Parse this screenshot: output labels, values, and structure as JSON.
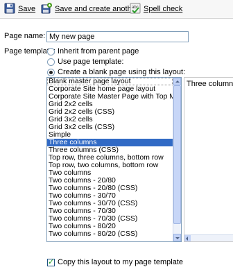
{
  "toolbar": {
    "save_label": "Save",
    "save_another_label": "Save and create another",
    "spell_label": "Spell check"
  },
  "form": {
    "page_name_label": "Page name:",
    "page_name_value": "My new page",
    "page_template_label": "Page template:",
    "radios": [
      {
        "label": "Inherit from parent page",
        "checked": false
      },
      {
        "label": "Use page template:",
        "checked": false
      },
      {
        "label": "Create a blank page using this layout:",
        "checked": true
      }
    ],
    "layouts": [
      "Blank master page layout",
      "Corporate Site home page layout",
      "Corporate Site Master Page with Top Menu",
      "Grid 2x2 cells",
      "Grid 2x2 cells (CSS)",
      "Grid 3x2 cells",
      "Grid 3x2 cells (CSS)",
      "Simple",
      "Three columns",
      "Three columns (CSS)",
      "Top row, three columns, bottom row",
      "Top row, two columns, bottom row",
      "Two columns",
      "Two columns - 20/80",
      "Two columns - 20/80 (CSS)",
      "Two columns - 30/70",
      "Two columns - 30/70 (CSS)",
      "Two columns - 70/30",
      "Two columns - 70/30 (CSS)",
      "Two columns - 80/20",
      "Two columns - 80/20 (CSS)"
    ],
    "selected_layout": "Three columns",
    "preview_text": "Three columns w",
    "copy_layout_label": "Copy this layout to my page template",
    "copy_layout_checked": true
  },
  "colors": {
    "selection": "#316ac5",
    "input_border": "#7f9db9"
  }
}
